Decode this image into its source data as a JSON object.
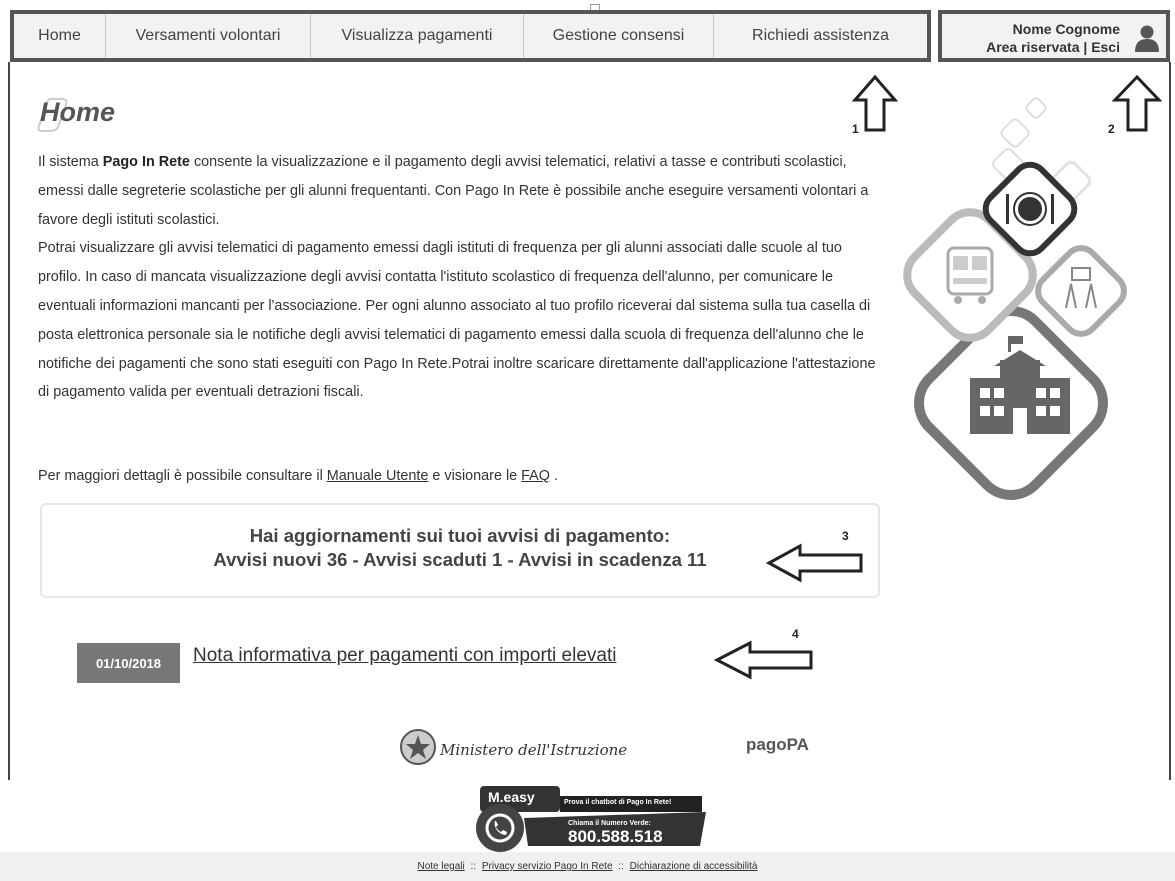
{
  "nav": {
    "items": [
      {
        "label": "Home"
      },
      {
        "label": "Versamenti volontari"
      },
      {
        "label": "Visualizza pagamenti"
      },
      {
        "label": "Gestione consensi"
      },
      {
        "label": "Richiedi assistenza"
      }
    ]
  },
  "user": {
    "name": "Nome Cognome",
    "area_label": "Area riservata",
    "separator": "|",
    "logout_label": "Esci",
    "avatar_icon": "user-icon"
  },
  "page": {
    "title": "Home",
    "intro_prefix": "Il sistema ",
    "intro_brand": "Pago In Rete",
    "intro_text_1": " consente la visualizzazione e il pagamento degli avvisi telematici, relativi a tasse e contributi scolastici, emessi dalle segreterie scolastiche per gli alunni frequentanti. Con Pago In Rete è possibile anche eseguire versamenti volontari a favore degli istituti scolastici.",
    "intro_text_2": "Potrai visualizzare gli avvisi telematici di pagamento emessi dagli istituti di frequenza per gli alunni associati dalle scuole al tuo profilo. In caso di mancata visualizzazione degli avvisi contatta l'istituto scolastico di frequenza dell'alunno, per comunicare le eventuali informazioni mancanti per l'associazione. Per ogni alunno associato al tuo profilo riceverai dal sistema sulla tua casella di posta elettronica personale sia le notifiche degli avvisi telematici di pagamento emessi dalla scuola di frequenza dell'alunno che le notifiche dei pagamenti che sono stati eseguiti con Pago In Rete.Potrai inoltre scaricare direttamente dall'applicazione l'attestazione di pagamento valida per eventuali detrazioni fiscali.",
    "details_prefix": "Per maggiori dettagli è possibile consultare il ",
    "manual_link": "Manuale Utente",
    "details_middle": " e visionare le ",
    "faq_link": "FAQ",
    "details_suffix": " ."
  },
  "notice": {
    "line1": "Hai aggiornamenti sui tuoi avvisi di pagamento:",
    "line2": "Avvisi nuovi 36 - Avvisi scaduti 1 - Avvisi in scadenza 11"
  },
  "news": {
    "date": "01/10/2018",
    "title": "Nota informativa per pagamenti con importi elevati"
  },
  "annotations": {
    "a1": "1",
    "a2": "2",
    "a3": "3",
    "a4": "4"
  },
  "logos": {
    "ministry": "Ministero dell'Istruzione",
    "pagopa": "pagoPA"
  },
  "meeasy": {
    "brand": "M.easy",
    "chatbot_text": "Prova il chatbot di Pago In Rete!",
    "call_label": "Chiama il Numero Verde:",
    "phone": "800.588.518"
  },
  "footer": {
    "legal": "Note legali",
    "privacy": "Privacy servizio Pago In Rete",
    "accessibility": "Dichiarazione di accessibilità",
    "sep": "::"
  }
}
